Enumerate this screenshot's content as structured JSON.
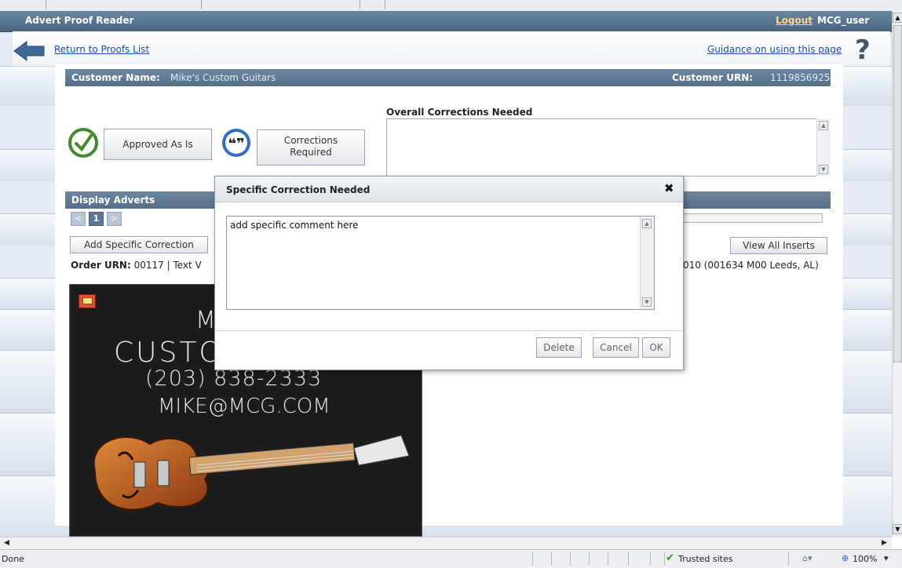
{
  "app": {
    "title": "Advert Proof Reader",
    "logout_label": "Logout",
    "username": "MCG_user"
  },
  "nav": {
    "return_label": "Return to Proofs List",
    "guidance_label": "Guidance on using this page",
    "help_glyph": "?"
  },
  "customer": {
    "name_label": "Customer Name:",
    "name_value": "Mike's Custom Guitars",
    "urn_label": "Customer URN:",
    "urn_value": "1119856925"
  },
  "actions": {
    "approved_label": "Approved As Is",
    "corrections_label_line1": "Corrections",
    "corrections_label_line2": "Required"
  },
  "overall": {
    "label": "Overall Corrections Needed",
    "value": ""
  },
  "display": {
    "header": "Display Adverts",
    "page_prev": "<",
    "page_current": "1",
    "page_next": ">",
    "add_specific_label": "Add Specific Correction",
    "view_inserts_label": "View All Inserts",
    "order_label": "Order URN:",
    "order_value": "00117 | Text V",
    "order_tail": "010 (001634 M00 Leeds, AL)"
  },
  "advert": {
    "line1": "M",
    "line2": "CUSTO",
    "phone": "(203) 838-2333",
    "email": "MIKE@MCG.COM"
  },
  "modal": {
    "title": "Specific Correction Needed",
    "close_glyph": "✖",
    "comment_text": "add specific comment here",
    "delete_label": "Delete",
    "cancel_label": "Cancel",
    "ok_label": "OK"
  },
  "statusbar": {
    "left_text": "Done",
    "zone_text": "Trusted sites",
    "zoom_text": "100%"
  },
  "icons": {
    "back": "back-arrow-icon",
    "approve": "check-circle-icon",
    "corrections": "quote-bubble-icon",
    "help": "help-icon",
    "comment": "comment-icon"
  },
  "colors": {
    "header_bar": "#556f89",
    "link": "#1e4ea3",
    "logout": "#ffd98c",
    "approve_green": "#3f8a2c",
    "corrections_blue": "#2f6fc0",
    "advert_bg": "#1c1c1c"
  }
}
